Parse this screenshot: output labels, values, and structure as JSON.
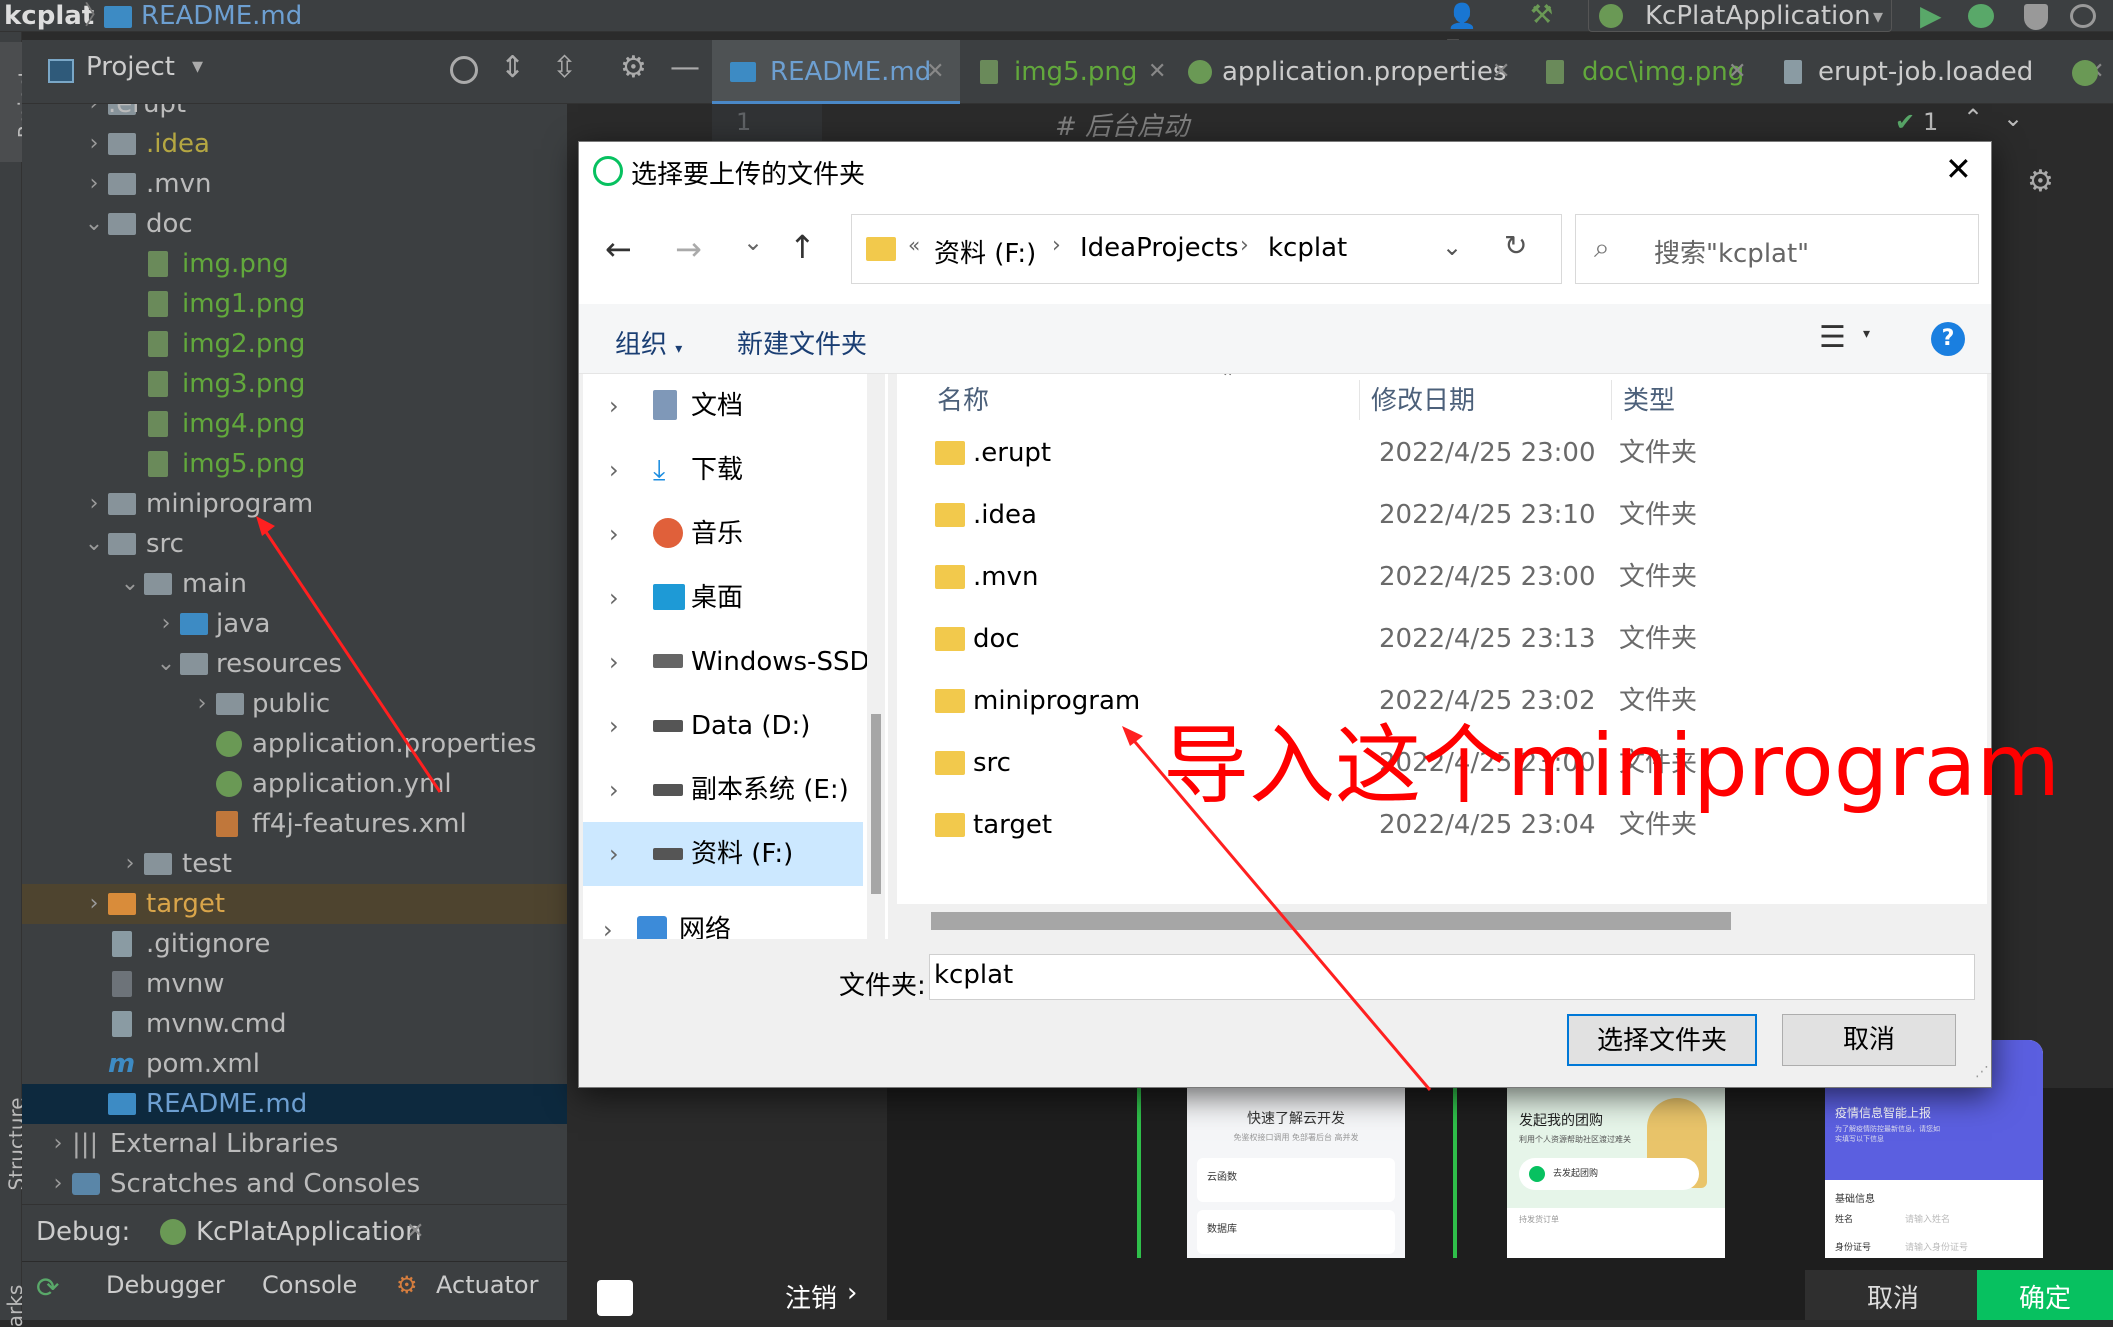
{
  "ide": {
    "top_bar": {
      "project_name": "kcplat",
      "open_file": "README.md",
      "run_config": "KcPlatApplication"
    },
    "side_labels": {
      "project": "Project",
      "structure": "Structure",
      "bookmarks": "arks"
    },
    "project_panel": {
      "title": "Project",
      "tree": [
        {
          "label": ".erupt",
          "type": "folder",
          "depth": 1,
          "expanded": false
        },
        {
          "label": ".idea",
          "type": "folder",
          "depth": 1,
          "expanded": false
        },
        {
          "label": ".mvn",
          "type": "folder",
          "depth": 1,
          "expanded": false
        },
        {
          "label": "doc",
          "type": "folder",
          "depth": 1,
          "expanded": true
        },
        {
          "label": "img.png",
          "type": "image",
          "depth": 2
        },
        {
          "label": "img1.png",
          "type": "image",
          "depth": 2
        },
        {
          "label": "img2.png",
          "type": "image",
          "depth": 2
        },
        {
          "label": "img3.png",
          "type": "image",
          "depth": 2
        },
        {
          "label": "img4.png",
          "type": "image",
          "depth": 2
        },
        {
          "label": "img5.png",
          "type": "image",
          "depth": 2
        },
        {
          "label": "miniprogram",
          "type": "folder",
          "depth": 1,
          "expanded": false
        },
        {
          "label": "src",
          "type": "folder",
          "depth": 1,
          "expanded": true
        },
        {
          "label": "main",
          "type": "folder",
          "depth": 2,
          "expanded": true
        },
        {
          "label": "java",
          "type": "folder-blue",
          "depth": 3,
          "expanded": false
        },
        {
          "label": "resources",
          "type": "folder",
          "depth": 3,
          "expanded": true
        },
        {
          "label": "public",
          "type": "folder",
          "depth": 4,
          "expanded": false
        },
        {
          "label": "application.properties",
          "type": "spring",
          "depth": 4
        },
        {
          "label": "application.yml",
          "type": "spring",
          "depth": 4
        },
        {
          "label": "ff4j-features.xml",
          "type": "xml",
          "depth": 4
        },
        {
          "label": "test",
          "type": "folder",
          "depth": 2,
          "expanded": false
        },
        {
          "label": "target",
          "type": "folder-orange",
          "depth": 1,
          "expanded": false
        },
        {
          "label": ".gitignore",
          "type": "file",
          "depth": 1
        },
        {
          "label": "mvnw",
          "type": "file",
          "depth": 1
        },
        {
          "label": "mvnw.cmd",
          "type": "file",
          "depth": 1
        },
        {
          "label": "pom.xml",
          "type": "maven",
          "depth": 1
        },
        {
          "label": "README.md",
          "type": "md",
          "depth": 1
        },
        {
          "label": "External Libraries",
          "type": "lib",
          "depth": 0,
          "expanded": false
        },
        {
          "label": "Scratches and Consoles",
          "type": "scratch",
          "depth": 0,
          "expanded": false
        }
      ]
    },
    "editor_tabs": [
      "README.md",
      "img5.png",
      "application.properties",
      "doc\\img.png",
      "erupt-job.loaded"
    ],
    "editor": {
      "line_number": "1",
      "line_text": "# 后台启动",
      "inspection_count": "1"
    },
    "debug": {
      "label": "Debug:",
      "config": "KcPlatApplication",
      "tabs": [
        "Debugger",
        "Console",
        "Actuator"
      ]
    },
    "preview": {
      "logout": "注销",
      "cancel": "取消",
      "confirm": "确定",
      "cards": [
        {
          "title": "快速了解云开发",
          "subtitle": "免鉴权接口调用 免部署后台 高并发",
          "items": [
            "云函数",
            "数据库"
          ]
        },
        {
          "title": "发起我的团购",
          "subtitle": "利用个人资源帮助社区渡过难关",
          "button": "去发起团购",
          "footer": "持发货订单"
        },
        {
          "title": "疫情信息智能上报",
          "subtitle": "为了解疫情防控最新信息，请您如实填写以下信息",
          "section": "基础信息",
          "fields": [
            "姓名",
            "身份证号"
          ],
          "placeholders": [
            "请输入姓名",
            "请输入身份证号"
          ]
        }
      ]
    },
    "annotation": "导入这个miniprogram"
  },
  "dialog": {
    "title": "选择要上传的文件夹",
    "breadcrumb": [
      "资料 (F:)",
      "IdeaProjects",
      "kcplat"
    ],
    "breadcrumb_prefix": "«",
    "search_placeholder": "搜索\"kcplat\"",
    "toolbar": {
      "organize": "组织",
      "new_folder": "新建文件夹"
    },
    "nav": [
      "文档",
      "下载",
      "音乐",
      "桌面",
      "Windows-SSD",
      "Data (D:)",
      "副本系统 (E:)",
      "资料 (F:)",
      "网络"
    ],
    "columns": {
      "name": "名称",
      "date": "修改日期",
      "type": "类型"
    },
    "files": [
      {
        "name": ".erupt",
        "date": "2022/4/25 23:00",
        "type": "文件夹"
      },
      {
        "name": ".idea",
        "date": "2022/4/25 23:10",
        "type": "文件夹"
      },
      {
        "name": ".mvn",
        "date": "2022/4/25 23:00",
        "type": "文件夹"
      },
      {
        "name": "doc",
        "date": "2022/4/25 23:13",
        "type": "文件夹"
      },
      {
        "name": "miniprogram",
        "date": "2022/4/25 23:02",
        "type": "文件夹"
      },
      {
        "name": "src",
        "date": "2022/4/25 23:00",
        "type": "文件夹"
      },
      {
        "name": "target",
        "date": "2022/4/25 23:04",
        "type": "文件夹"
      }
    ],
    "folder_label": "文件夹:",
    "folder_value": "kcplat",
    "select_button": "选择文件夹",
    "cancel_button": "取消"
  },
  "colors": {
    "ide_bg": "#2b2b2b",
    "panel_bg": "#3c3f41",
    "selection": "#0d293e",
    "annotation_red": "#ff0000",
    "dialog_bg": "#f0f0f0",
    "folder_yellow": "#f2c94c",
    "confirm_green": "#07c160"
  }
}
